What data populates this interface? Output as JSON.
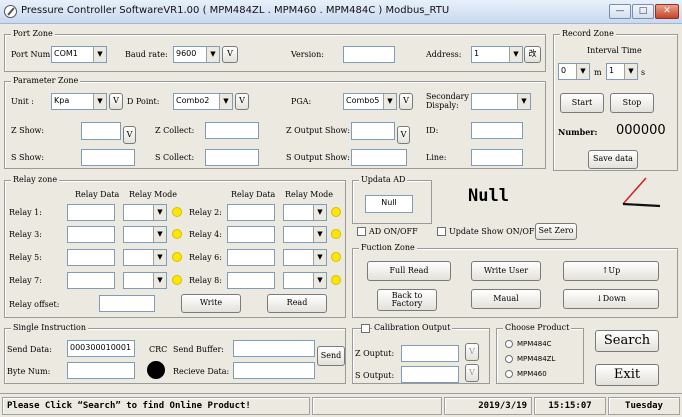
{
  "window": {
    "title": "Pressure Controller SoftwareVR1.00 ( MPM484ZL . MPM460 . MPM484C ) Modbus_RTU",
    "min_icon": "minimize-icon",
    "max_icon": "maximize-icon",
    "close_icon": "close-icon"
  },
  "port_zone": {
    "label": "Port Zone",
    "port_num_label": "Port Num:",
    "port_num_value": "COM1",
    "baud_label": "Baud rate:",
    "baud_value": "9600",
    "baud_btn": "V",
    "version_label": "Version:",
    "version_value": "",
    "address_label": "Address:",
    "address_value": "1",
    "change_btn": "改"
  },
  "param_zone": {
    "label": "Parameter Zone",
    "unit_label": "Unit  :",
    "unit_value": "Kpa",
    "unit_btn": "V",
    "dpoint_label": "D Point:",
    "dpoint_value": "Combo2",
    "dpoint_btn": "V",
    "pga_label": "PGA:",
    "pga_value": "Combo5",
    "pga_btn": "V",
    "secondary_label_1": "Secondary",
    "secondary_label_2": "Dispaly:",
    "secondary_value": "",
    "z_show_label": "Z Show:",
    "z_show_btn": "V",
    "z_collect_label": "Z Collect:",
    "z_output_show_label": "Z Output Show:",
    "z_output_show_btn": "V",
    "id_label": "ID:",
    "s_show_label": "S Show:",
    "s_collect_label": "S Collect:",
    "s_output_show_label": "S Output Show:",
    "line_label": "Line:"
  },
  "record_zone": {
    "label": "Record Zone",
    "interval_label": "Interval Time",
    "interval_a": "0",
    "m_label": "m",
    "interval_b": "1",
    "s_label": "s",
    "start_btn": "Start",
    "stop_btn": "Stop",
    "number_label": "Number:",
    "number_value": "000000",
    "save_btn": "Save data"
  },
  "relay_zone": {
    "label": "Relay zone",
    "header_data": "Relay Data",
    "header_mode": "Relay Mode",
    "left": [
      {
        "label": "Relay 1:"
      },
      {
        "label": "Relay 3:"
      },
      {
        "label": "Relay 5:"
      },
      {
        "label": "Relay 7:"
      }
    ],
    "right": [
      {
        "label": "Relay 2:"
      },
      {
        "label": "Relay 4:"
      },
      {
        "label": "Relay 6:"
      },
      {
        "label": "Relay 8:"
      }
    ],
    "offset_label": "Relay offset:",
    "write_btn": "Write",
    "read_btn": "Read"
  },
  "update_ad": {
    "label": "Updata AD",
    "value": "Null",
    "ad_onoff_label": "AD ON/OFF",
    "update_show_label": "Update Show ON/OFF",
    "set_zero_btn": "Set Zero",
    "big_value": "Null"
  },
  "function_zone": {
    "label": "Fuction Zone",
    "full_read_btn": "Full Read",
    "write_user_btn": "Write User",
    "up_btn": "↑Up",
    "back_factory_btn_1": "Back to",
    "back_factory_btn_2": "Factory",
    "manual_btn": "Maual",
    "down_btn": "↓Down"
  },
  "single_instruction": {
    "label": "Single Instruction",
    "send_data_label": "Send Data:",
    "send_data_value": "000300010001",
    "crc_label": "CRC",
    "send_buffer_label": "Send Buffer:",
    "send_btn": "Send",
    "byte_num_label": "Byte Num:",
    "receive_label": "Recieve Data:"
  },
  "calibration": {
    "label": "Calibration Output",
    "z_output_label": "Z Ouptut:",
    "s_output_label": "S Output:",
    "btn": "V"
  },
  "choose_product": {
    "label": "Choose Product",
    "options": [
      "MPM484C",
      "MPM484ZL",
      "MPM460"
    ]
  },
  "actions": {
    "search_btn": "Search",
    "exit_btn": "Exit"
  },
  "status": {
    "message": "Please Click “Search” to find Online Product!",
    "date": "2019/3/19",
    "time": "15:15:07",
    "day": "Tuesday"
  },
  "colors": {
    "indicator": "#ffe600",
    "crc_indicator": "#000000",
    "gauge_needle": "#d32020"
  }
}
